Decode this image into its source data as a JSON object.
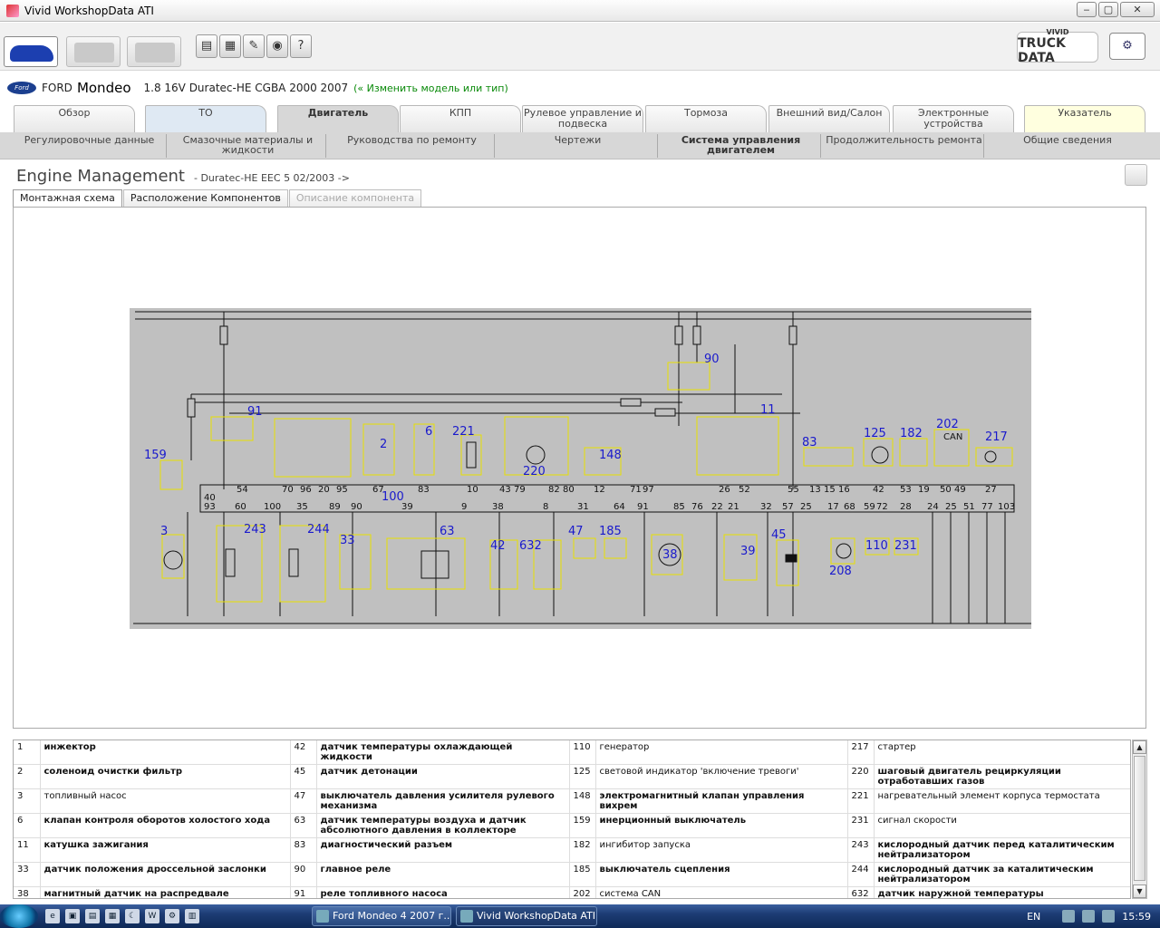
{
  "window": {
    "title": "Vivid WorkshopData ATI",
    "min": "‒",
    "max": "▢",
    "close": "✕"
  },
  "toolbar": {
    "buttons": [
      "▤",
      "▦",
      "✎",
      "◉",
      "?"
    ],
    "logo_top": "VIVID",
    "logo_main": "TRUCK DATA"
  },
  "model": {
    "brand_badge": "Ford",
    "brand": "FORD",
    "name": "Mondeo",
    "variant": "1.8 16V Duratec-HE CGBA 2000 2007",
    "change_link": "(« Изменить модель или тип)"
  },
  "main_tabs": [
    "Обзор",
    "ТО",
    "Двигатель",
    "КПП",
    "Рулевое управление и подвеска",
    "Тормоза",
    "Внешний вид/Салон",
    "Электронные устройства",
    "Указатель"
  ],
  "sub_tabs": [
    "Регулировочные данные",
    "Смазочные материалы и жидкости",
    "Руководства по ремонту",
    "Чертежи",
    "Система управления двигателем",
    "Продолжительность ремонта",
    "Общие сведения"
  ],
  "section": {
    "title": "Engine Management",
    "subtitle": "- Duratec-HE EEC 5 02/2003 ->"
  },
  "view_tabs": [
    "Монтажная схема",
    "Расположение Компонентов",
    "Описание компонента"
  ],
  "diagram": {
    "component_ids": [
      "90",
      "91",
      "159",
      "2",
      "6",
      "221",
      "148",
      "11",
      "83",
      "125",
      "182",
      "202",
      "217",
      "100",
      "3",
      "243",
      "244",
      "33",
      "63",
      "42",
      "632",
      "47",
      "185",
      "38",
      "39",
      "45",
      "208",
      "110",
      "231",
      "220"
    ],
    "top_pins": [
      "54",
      "70",
      "96",
      "20",
      "95",
      "67",
      "83",
      "10",
      "43",
      "79",
      "82",
      "80",
      "12",
      "71",
      "97",
      "26",
      "52",
      "55",
      "13",
      "15",
      "16",
      "42",
      "53",
      "19",
      "50",
      "49",
      "27",
      "40"
    ],
    "bottom_pins": [
      "93",
      "60",
      "100",
      "35",
      "89",
      "90",
      "39",
      "9",
      "38",
      "8",
      "31",
      "64",
      "91",
      "85",
      "76",
      "22",
      "21",
      "32",
      "57",
      "25",
      "17",
      "68",
      "59",
      "72",
      "28",
      "24",
      "25",
      "51",
      "77",
      "103"
    ],
    "can_label": "CAN"
  },
  "legend": [
    [
      [
        "1",
        "инжектор"
      ],
      [
        "42",
        "датчик температуры охлаждающей жидкости"
      ],
      [
        "110",
        "генератор"
      ],
      [
        "217",
        "стартер"
      ]
    ],
    [
      [
        "2",
        "соленоид очистки фильтр"
      ],
      [
        "45",
        "датчик детонации"
      ],
      [
        "125",
        "световой индикатор 'включение тревоги'"
      ],
      [
        "220",
        "шаговый двигатель рециркуляции отработавших газов"
      ]
    ],
    [
      [
        "3",
        "топливный насос"
      ],
      [
        "47",
        "выключатель давления усилителя рулевого механизма"
      ],
      [
        "148",
        "электромагнитный клапан управления вихрем"
      ],
      [
        "221",
        "нагревательный элемент корпуса термостата"
      ]
    ],
    [
      [
        "6",
        "клапан контроля оборотов холостого хода"
      ],
      [
        "63",
        "датчик температуры воздуха и датчик абсолютного давления в коллекторе"
      ],
      [
        "159",
        "инерционный выключатель"
      ],
      [
        "231",
        "сигнал скорости"
      ]
    ],
    [
      [
        "11",
        "катушка зажигания"
      ],
      [
        "83",
        "диагностический разъем"
      ],
      [
        "182",
        "ингибитор запуска"
      ],
      [
        "243",
        "кислородный датчик перед каталитическим нейтрализатором"
      ]
    ],
    [
      [
        "33",
        "датчик положения дроссельной заслонки"
      ],
      [
        "90",
        "главное реле"
      ],
      [
        "185",
        "выключатель сцепления"
      ],
      [
        "244",
        "кислородный датчик за каталитическим нейтрализатором"
      ]
    ],
    [
      [
        "38",
        "магнитный датчик на распредвале"
      ],
      [
        "91",
        "реле топливного насоса"
      ],
      [
        "202",
        "система CAN"
      ],
      [
        "632",
        "датчик наружной температуры"
      ]
    ]
  ],
  "taskbar": {
    "quicklaunch": [
      "e",
      "▣",
      "▤",
      "▦",
      "☾",
      "W",
      "⚙",
      "▥"
    ],
    "tasks": [
      "Ford Mondeo 4 2007 г...",
      "Vivid WorkshopData ATI"
    ],
    "lang": "EN",
    "clock": "15:59"
  }
}
